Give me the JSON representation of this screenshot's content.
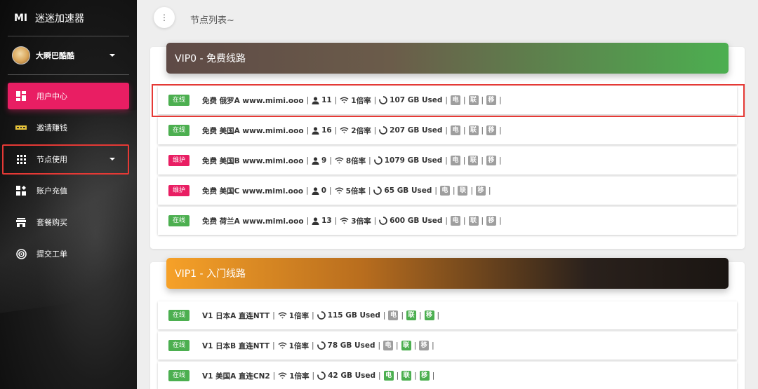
{
  "sidebar": {
    "logo_abbr": "MI",
    "logo_name": "迷迷加速器",
    "user_name": "大瞬巴酷酷",
    "items": [
      {
        "label": "用户中心",
        "icon": "dashboard-icon"
      },
      {
        "label": "邀请赚钱",
        "icon": "invite-icon"
      },
      {
        "label": "节点使用",
        "icon": "apps-grid-icon"
      },
      {
        "label": "账户充值",
        "icon": "recharge-icon"
      },
      {
        "label": "套餐购买",
        "icon": "store-icon"
      },
      {
        "label": "提交工单",
        "icon": "target-icon"
      }
    ]
  },
  "topbar": {
    "menu_icon": "⋮",
    "title": "节点列表~"
  },
  "groups": [
    {
      "title": "VIP0 - 免费线路",
      "nodes": [
        {
          "status": "在线",
          "name": "免费 俄罗A www.mimi.ooo",
          "users": "11",
          "rate": "1倍率",
          "traffic": "107 GB Used",
          "isp": [
            "电",
            "联",
            "移"
          ]
        },
        {
          "status": "在线",
          "name": "免费 美国A www.mimi.ooo",
          "users": "16",
          "rate": "2倍率",
          "traffic": "207 GB Used",
          "isp": [
            "电",
            "联",
            "移"
          ]
        },
        {
          "status": "维护",
          "name": "免费 美国B www.mimi.ooo",
          "users": "9",
          "rate": "8倍率",
          "traffic": "1079 GB Used",
          "isp": [
            "电",
            "联",
            "移"
          ]
        },
        {
          "status": "维护",
          "name": "免费 美国C www.mimi.ooo",
          "users": "0",
          "rate": "5倍率",
          "traffic": "65 GB Used",
          "isp": [
            "电",
            "联",
            "移"
          ]
        },
        {
          "status": "在线",
          "name": "免费 荷兰A www.mimi.ooo",
          "users": "13",
          "rate": "3倍率",
          "traffic": "600 GB Used",
          "isp": [
            "电",
            "联",
            "移"
          ]
        }
      ]
    },
    {
      "title": "VIP1 - 入门线路",
      "nodes": [
        {
          "status": "在线",
          "name": "V1 日本A 直连NTT",
          "rate": "1倍率",
          "traffic": "115 GB Used",
          "isp": [
            "电",
            "联",
            "移"
          ]
        },
        {
          "status": "在线",
          "name": "V1 日本B 直连NTT",
          "rate": "1倍率",
          "traffic": "78 GB Used",
          "isp": [
            "电",
            "联",
            "移"
          ]
        },
        {
          "status": "在线",
          "name": "V1 美国A 直连CN2",
          "rate": "1倍率",
          "traffic": "42 GB Used",
          "isp": [
            "电",
            "联",
            "移"
          ]
        }
      ]
    }
  ],
  "colors": {
    "accent": "#e91e63",
    "online": "#4caf50",
    "maintenance": "#e91e63",
    "isp_off": "#9e9e9e",
    "highlight": "#e53935"
  }
}
